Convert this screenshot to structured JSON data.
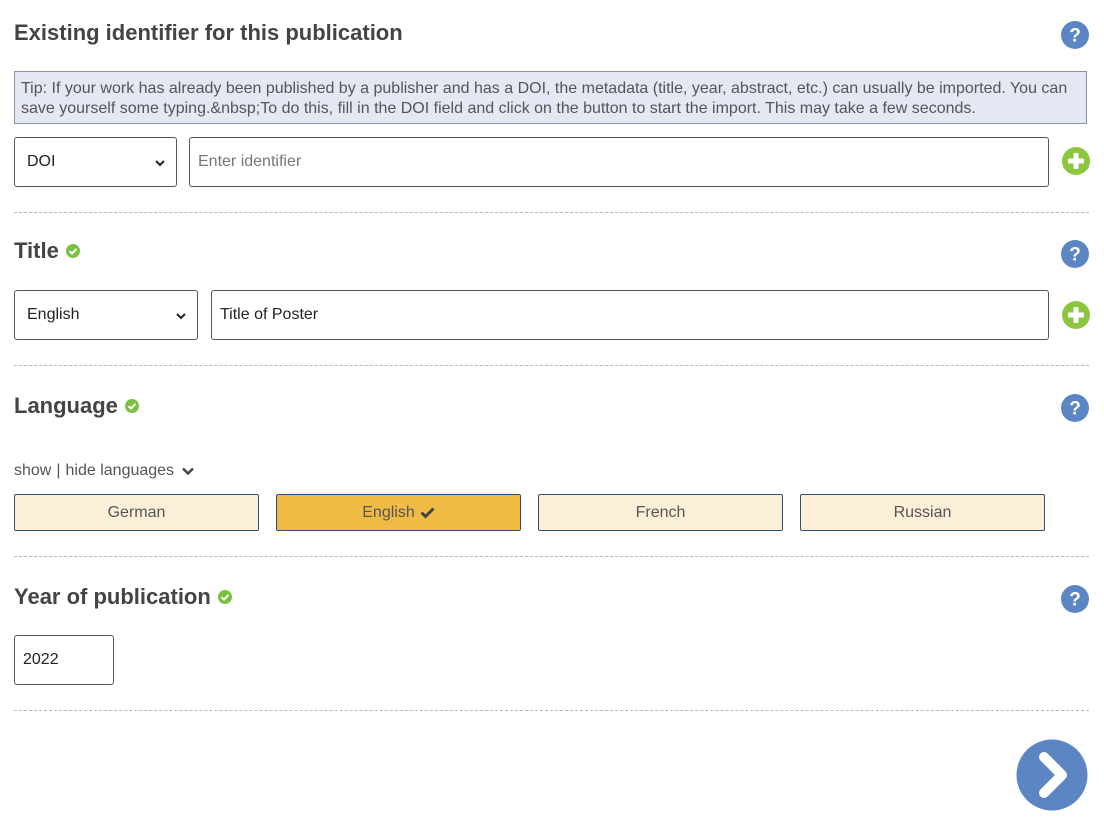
{
  "identifier": {
    "title": "Existing identifier for this publication",
    "tip": "Tip: If your work has already been published by a publisher and has a DOI, the metadata (title, year, abstract, etc.) can usually be imported. You can save yourself some typing.&nbsp;To do this, fill in the DOI field and click on the button to start the import. This may take a few seconds.",
    "type_select_value": "DOI",
    "input_placeholder": "Enter identifier"
  },
  "title_section": {
    "title": "Title",
    "language_select_value": "English",
    "title_value": "Title of Poster"
  },
  "language_section": {
    "title": "Language",
    "toggle_show": "show",
    "toggle_sep": "|",
    "toggle_hide": "hide languages",
    "languages": [
      {
        "label": "German",
        "selected": false
      },
      {
        "label": "English",
        "selected": true
      },
      {
        "label": "French",
        "selected": false
      },
      {
        "label": "Russian",
        "selected": false
      }
    ]
  },
  "year_section": {
    "title": "Year of publication",
    "year_value": "2022"
  },
  "colors": {
    "help_blue": "#5b86c3",
    "add_green": "#8cc63f",
    "ok_green": "#7ac142",
    "selected_lang": "#efbb44",
    "unselected_lang": "#fcefd8"
  },
  "icons": {
    "help": "question-circle-icon",
    "add": "plus-circle-icon",
    "ok": "check-circle-icon",
    "next": "chevron-right-circle-icon"
  }
}
